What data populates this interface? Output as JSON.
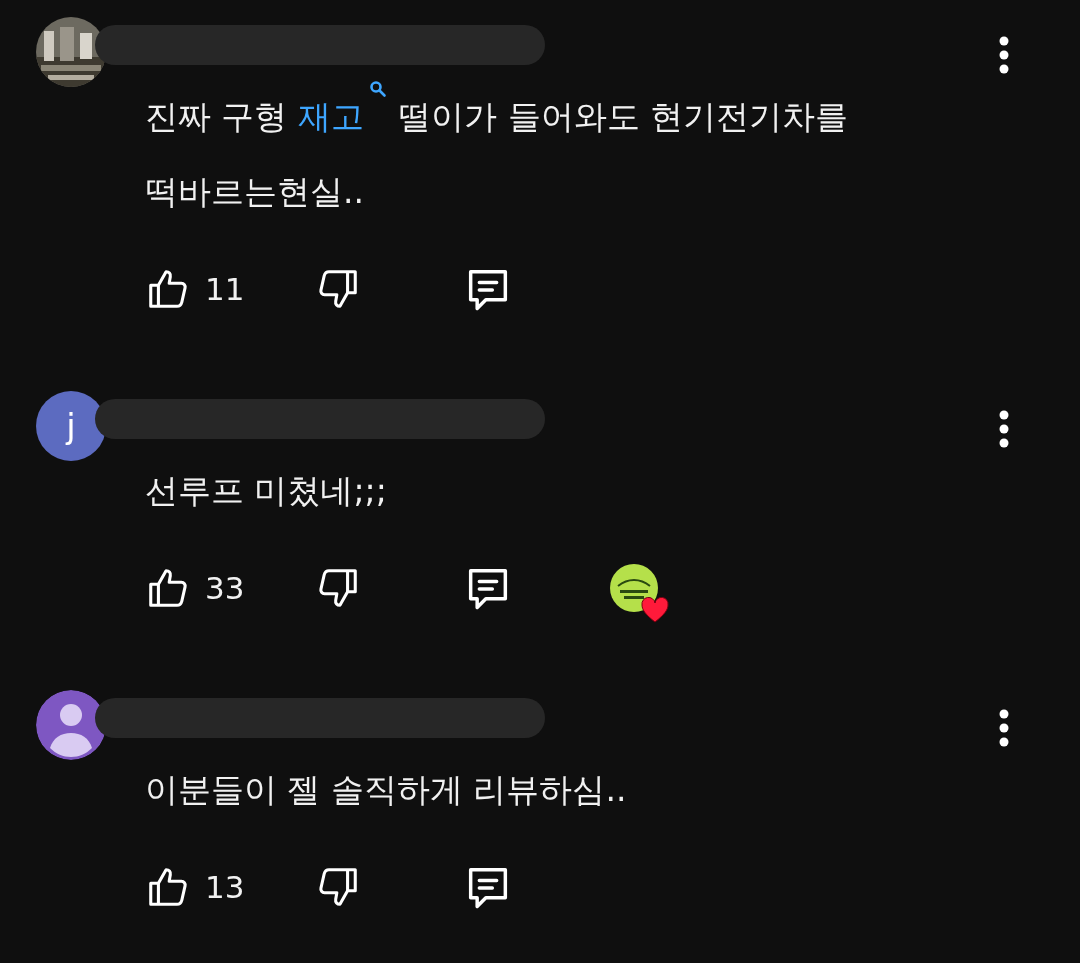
{
  "comments": [
    {
      "avatar": {
        "kind": "picture"
      },
      "lines": [
        [
          {
            "text": "진짜 구형 "
          },
          {
            "text": "재고",
            "kind": "search-link"
          },
          {
            "text": " 떨이가 들어와도 현기전기차를"
          }
        ],
        [
          {
            "text": "떡바르는현실.."
          }
        ]
      ],
      "likes": "11",
      "creator_heart": false
    },
    {
      "avatar": {
        "kind": "letter",
        "letter": "j",
        "color": "#5c6bc0"
      },
      "lines": [
        [
          {
            "text": "선루프 미쳤네;;;"
          }
        ]
      ],
      "likes": "33",
      "creator_heart": true
    },
    {
      "avatar": {
        "kind": "default",
        "color": "#7e57c2"
      },
      "lines": [
        [
          {
            "text": "이분들이 젤 솔직하게 리뷰하심.."
          }
        ]
      ],
      "likes": "13",
      "creator_heart": false
    }
  ]
}
